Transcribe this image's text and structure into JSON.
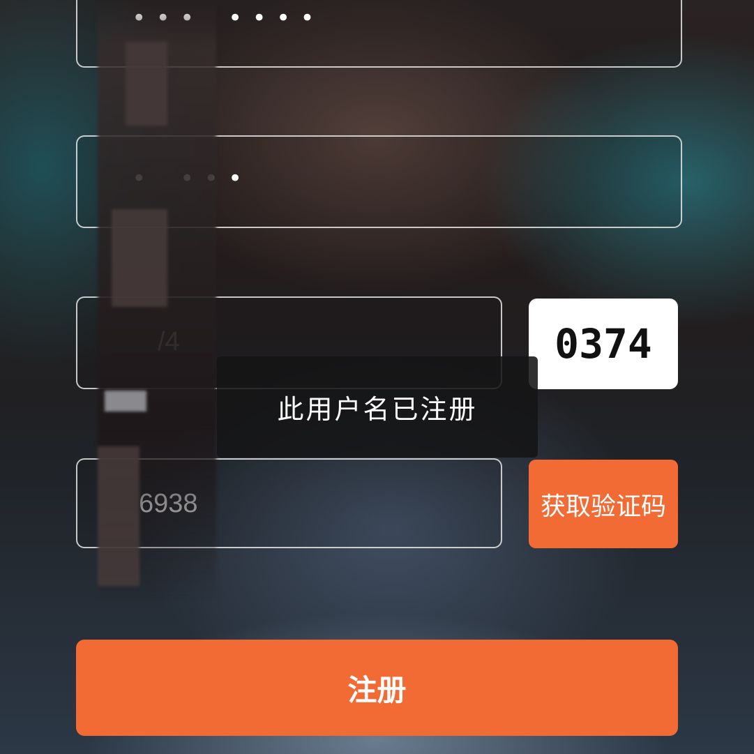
{
  "form": {
    "password_field": {
      "value": "•••  ••••"
    },
    "confirm_password_field": {
      "value": "•  •••"
    },
    "username_field": {
      "value": "/4"
    },
    "captcha": {
      "code": "0374"
    },
    "phone_field": {
      "value": "6938"
    },
    "get_code_button": {
      "label": "获取验证码"
    },
    "register_button": {
      "label": "注册"
    }
  },
  "toast": {
    "message": "此用户名已注册"
  },
  "colors": {
    "accent": "#f26b35",
    "field_border": "#e6e6e6",
    "toast_bg": "#141416"
  }
}
